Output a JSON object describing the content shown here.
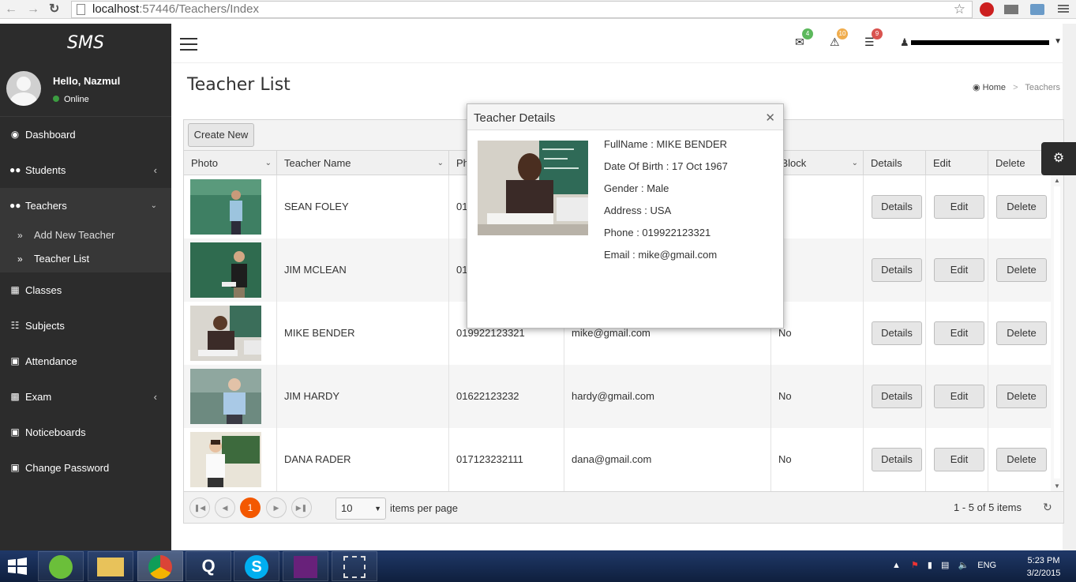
{
  "browser": {
    "url_host": "localhost",
    "url_path": ":57446/Teachers/Index"
  },
  "sidebar": {
    "brand": "SMS",
    "greeting": "Hello, Nazmul",
    "status": "Online",
    "items": [
      {
        "label": "Dashboard",
        "icon": "dashboard-icon"
      },
      {
        "label": "Students",
        "icon": "users-icon"
      },
      {
        "label": "Teachers",
        "icon": "users-icon"
      },
      {
        "label": "Classes",
        "icon": "grid-icon"
      },
      {
        "label": "Subjects",
        "icon": "sitemap-icon"
      },
      {
        "label": "Attendance",
        "icon": "calendar-icon"
      },
      {
        "label": "Exam",
        "icon": "bar-chart-icon"
      },
      {
        "label": "Noticeboards",
        "icon": "calendar-icon"
      },
      {
        "label": "Change Password",
        "icon": "calendar-icon"
      }
    ],
    "teacher_sub": [
      {
        "label": "Add New Teacher"
      },
      {
        "label": "Teacher List"
      }
    ]
  },
  "header": {
    "badges": {
      "messages": "4",
      "warnings": "10",
      "tasks": "9"
    },
    "badge_colors": {
      "messages": "#5cb85c",
      "warnings": "#f0ad4e",
      "tasks": "#d9534f"
    }
  },
  "page": {
    "title": "Teacher List",
    "breadcrumb_home": "Home",
    "breadcrumb_current": "Teachers",
    "create_button": "Create New"
  },
  "grid": {
    "columns": [
      "Photo",
      "Teacher Name",
      "Ph",
      "",
      "sBlock",
      "Details",
      "Edit",
      "Delete"
    ],
    "rows": [
      {
        "name": "SEAN FOLEY",
        "phone": "01",
        "email": "",
        "block": "o"
      },
      {
        "name": "JIM MCLEAN",
        "phone": "01",
        "email": "",
        "block": "o"
      },
      {
        "name": "MIKE BENDER",
        "phone": "019922123321",
        "email": "mike@gmail.com",
        "block": "No"
      },
      {
        "name": "JIM HARDY",
        "phone": "01622123232",
        "email": "hardy@gmail.com",
        "block": "No"
      },
      {
        "name": "DANA RADER",
        "phone": "017123232111",
        "email": "dana@gmail.com",
        "block": "No"
      }
    ],
    "details_label": "Details",
    "edit_label": "Edit",
    "delete_label": "Delete"
  },
  "pager": {
    "current_page": "1",
    "page_size": "10",
    "per_page_label": "items per page",
    "info": "1 - 5 of 5 items"
  },
  "modal": {
    "title": "Teacher Details",
    "lines": [
      "FullName : MIKE BENDER",
      "Date Of Birth : 17 Oct 1967",
      "Gender : Male",
      "Address : USA",
      "Phone : 019922123321",
      "Email : mike@gmail.com"
    ]
  },
  "taskbar": {
    "apps": [
      "Q",
      "S"
    ],
    "lang": "ENG",
    "time": "5:23 PM",
    "date": "3/2/2015"
  }
}
